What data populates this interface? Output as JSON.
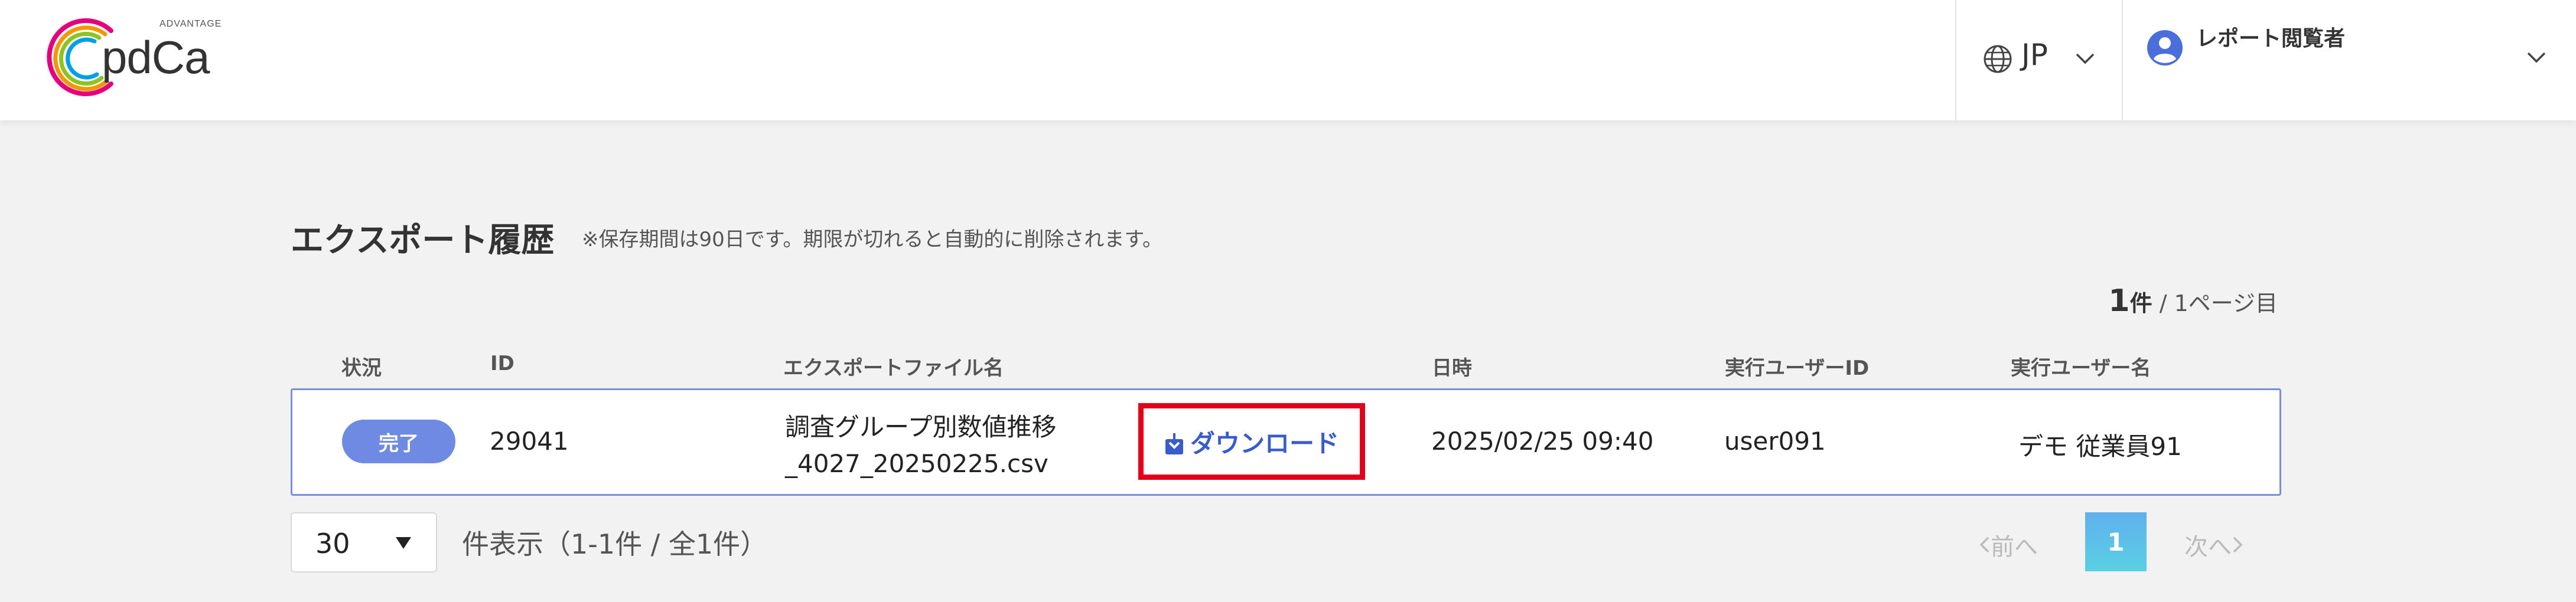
{
  "header": {
    "logo_tag": "ADVANTAGE",
    "logo_word": "pdCa",
    "language": "JP",
    "user_name": "レポート閲覧者"
  },
  "page": {
    "title": "エクスポート履歴",
    "note": "※保存期間は90日です。期限が切れると自動的に削除されます。",
    "count_num": "1",
    "count_unit": "件",
    "count_suffix": " / 1ページ目"
  },
  "table": {
    "headers": {
      "status": "状況",
      "id": "ID",
      "filename": "エクスポートファイル名",
      "datetime": "日時",
      "user_id": "実行ユーザーID",
      "user_name": "実行ユーザー名"
    },
    "rows": [
      {
        "status": "完了",
        "id": "29041",
        "filename_line1": "調査グループ別数値推移",
        "filename_line2": "_4027_20250225.csv",
        "download_label": "ダウンロード",
        "datetime": "2025/02/25 09:40",
        "user_id": "user091",
        "user_name": "デモ 従業員91"
      }
    ]
  },
  "footer": {
    "page_size": "30",
    "display_count": "件表示（1-1件 / 全1件）",
    "prev_label": "前へ",
    "current_page": "1",
    "next_label": "次へ"
  },
  "colors": {
    "badge": "#6f8ae2",
    "row_border": "#7b8ed8",
    "download_text": "#3a5bd0",
    "highlight_box": "#e3001b",
    "page_active": "#5fb0ec"
  }
}
